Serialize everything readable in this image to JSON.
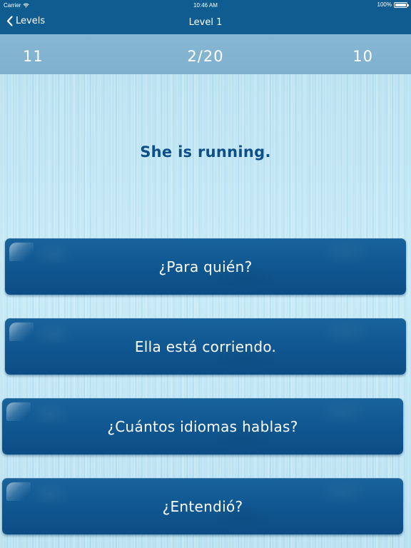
{
  "status_bar": {
    "carrier": "Carrier",
    "time": "10:46 AM",
    "battery": "100%",
    "battery_level": 1.0,
    "icons": [
      "wifi-icon",
      "battery-icon"
    ]
  },
  "nav": {
    "back_label": "Levels",
    "title": "Level 1",
    "back_icon": "chevron-left-icon"
  },
  "scores": {
    "left": "11",
    "progress": "2/20",
    "right": "10"
  },
  "prompt": "She is running.",
  "answers": [
    {
      "label": "¿Para quién?"
    },
    {
      "label": "Ella está corriendo."
    },
    {
      "label": "¿Cuántos idiomas hablas?"
    },
    {
      "label": "¿Entendió?"
    }
  ],
  "colors": {
    "nav_bar": "#0e5c90",
    "score_strip": "#86b7d3",
    "prompt_text": "#0d4f86",
    "button": "#0f5690",
    "background": "#c0e7f5"
  }
}
